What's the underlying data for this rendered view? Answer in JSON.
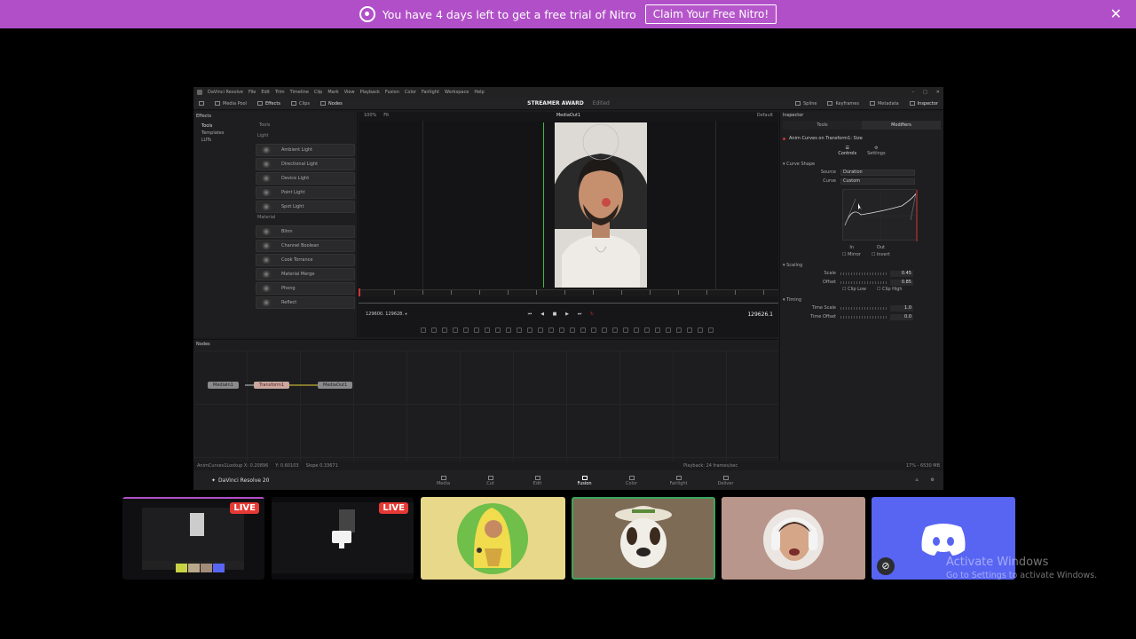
{
  "banner": {
    "message": "You have 4 days left to get a free trial of Nitro",
    "cta_label": "Claim Your Free Nitro!",
    "color": "#b14fc8"
  },
  "resolve": {
    "menu": [
      "DaVinci Resolve",
      "File",
      "Edit",
      "Trim",
      "Timeline",
      "Clip",
      "Mark",
      "View",
      "Playback",
      "Fusion",
      "Color",
      "Fairlight",
      "Workspace",
      "Help"
    ],
    "toolbar_left": [
      "Media Pool",
      "Effects",
      "Clips",
      "Nodes"
    ],
    "project_title": "STREAMER AWARD",
    "project_state": "Edited",
    "toolbar_right": [
      "Spline",
      "Keyframes",
      "Metadata",
      "Inspector"
    ],
    "effects": {
      "header": "Effects",
      "tree": [
        "Tools",
        "Templates",
        "LUTs"
      ],
      "list_header": "Tools",
      "sections": [
        {
          "name": "Light",
          "items": [
            "Ambient Light",
            "Directional Light",
            "Device Light",
            "Point Light",
            "Spot Light"
          ]
        },
        {
          "name": "Material",
          "items": [
            "Blinn",
            "Channel Boolean",
            "Cook Torrance",
            "Material Merge",
            "Phong",
            "Reflect"
          ]
        }
      ]
    },
    "viewer": {
      "zoom": "100%",
      "fit": "Fit",
      "name": "MediaOut1",
      "lut": "Default",
      "timecode_left": "129600.",
      "timecode_left2": "129628.",
      "timecode_right": "129626.1"
    },
    "inspector": {
      "header": "Inspector",
      "tabs": [
        "Tools",
        "Modifiers"
      ],
      "title": "Anim Curves on Transform1: Size",
      "subtabs": [
        "Controls",
        "Settings"
      ],
      "curve_shape": {
        "section": "Curve Shape",
        "source_label": "Source",
        "source_value": "Duration",
        "curve_label": "Curve",
        "curve_value": "Custom",
        "in_label": "In",
        "out_label": "Out",
        "mirror_label": "Mirror",
        "invert_label": "Invert"
      },
      "scaling": {
        "section": "Scaling",
        "scale_label": "Scale",
        "scale_value": "0.45",
        "offset_label": "Offset",
        "offset_value": "0.85",
        "clip_low_label": "Clip Low",
        "clip_high_label": "Clip High"
      },
      "timing": {
        "section": "Timing",
        "time_scale_label": "Time Scale",
        "time_scale_value": "1.0",
        "time_offset_label": "Time Offset",
        "time_offset_value": "0.0"
      }
    },
    "nodes": {
      "header": "Nodes",
      "items": [
        "MediaIn1",
        "Transform1",
        "MediaOut1"
      ]
    },
    "status": {
      "left": "AnimCurves1Lookup X: 0.20896",
      "y": "Y: 0.60103",
      "slope": "Slope 0.33671",
      "playback": "Playback: 24 frames/sec",
      "memory": "17% - 6530 MB"
    },
    "pages": {
      "brand": "DaVinci Resolve 20",
      "items": [
        "Media",
        "Cut",
        "Edit",
        "Fusion",
        "Color",
        "Fairlight",
        "Deliver"
      ],
      "active": "Fusion"
    }
  },
  "streams": {
    "live_label": "LIVE",
    "discord_color": "#5865f2"
  },
  "watermark": {
    "title": "Activate Windows",
    "subtitle": "Go to Settings to activate Windows."
  }
}
